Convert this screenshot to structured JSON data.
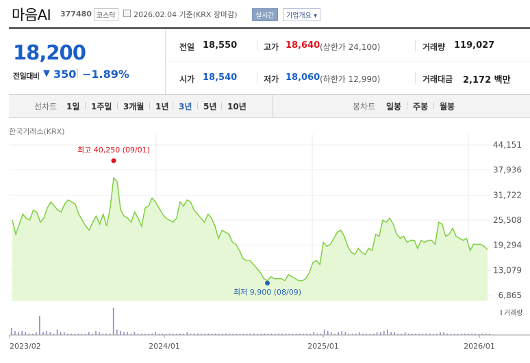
{
  "header": {
    "title": "마음AI",
    "code": "377480",
    "market": "코스닥",
    "date": "2026.02.04  기준(KRX 장마감)",
    "realtime": "실시간",
    "company_info": "기업개요 ▾"
  },
  "price": {
    "current": "18,200",
    "change_label": "전일대비",
    "change_arrow": "▼",
    "change_value": "350",
    "change_pct": "−1.89%"
  },
  "stats": {
    "prev_close_label": "전일",
    "prev_close": "18,550",
    "high_label": "고가",
    "high": "18,640",
    "upper_limit": "(상한가 24,100)",
    "volume_label": "거래량",
    "volume": "119,027",
    "open_label": "시가",
    "open": "18,540",
    "low_label": "저가",
    "low": "18,060",
    "lower_limit": "(하한가 12,990)",
    "value_label": "거래대금",
    "value": "2,172 백만"
  },
  "toolbar": {
    "line_label": "선차트",
    "periods": [
      "1일",
      "1주일",
      "3개월",
      "1년",
      "3년",
      "5년",
      "10년"
    ],
    "active_period": "3년",
    "candle_label": "봉차트",
    "candles": [
      "일봉",
      "주봉",
      "월봉"
    ]
  },
  "chart": {
    "exchange": "한국거래소(KRX)",
    "max_label": "최고 40,250 (09/01)",
    "min_label": "최저 9,900 (08/09)",
    "volume_legend": "거래량",
    "colors": {
      "line": "#7ccf3f",
      "fill": "#e6f7d6",
      "max": "#e0131b",
      "min": "#2b63b8",
      "volume": "#9b88c5"
    }
  },
  "chart_data": {
    "type": "area",
    "x_ticks": [
      "2023/02",
      "2024/01",
      "2025/01",
      "2026/01"
    ],
    "y_ticks": [
      "44,151",
      "37,936",
      "31,722",
      "25,508",
      "19,294",
      "13,079",
      "6,865"
    ],
    "ylim": [
      6865,
      44151
    ],
    "grid": true,
    "max_point": {
      "date": "09/01",
      "value": 40250
    },
    "min_point": {
      "date": "08/09",
      "value": 9900
    },
    "values": [
      25500,
      22000,
      24500,
      27000,
      26000,
      25500,
      28000,
      27500,
      25000,
      26000,
      28500,
      30000,
      29000,
      28000,
      27500,
      29500,
      30500,
      30000,
      29500,
      27000,
      25500,
      24000,
      23000,
      25000,
      26500,
      24500,
      27000,
      24000,
      28500,
      36000,
      35000,
      28000,
      26500,
      26000,
      25000,
      27500,
      26000,
      24000,
      28500,
      29000,
      31000,
      30000,
      28500,
      27000,
      26000,
      25500,
      25000,
      26000,
      30000,
      29000,
      30500,
      30000,
      28000,
      27000,
      26000,
      25000,
      27000,
      26000,
      24000,
      21000,
      23000,
      22500,
      22000,
      20000,
      19500,
      18000,
      16000,
      15500,
      15500,
      14500,
      13500,
      12500,
      11000,
      10500,
      11500,
      11000,
      11000,
      11000,
      10500,
      12000,
      11500,
      11000,
      10500,
      10500,
      11000,
      12500,
      15000,
      15500,
      14500,
      20000,
      19000,
      19500,
      21000,
      22500,
      23000,
      21500,
      19000,
      17500,
      17000,
      18500,
      17500,
      17000,
      18500,
      18000,
      22000,
      21500,
      25500,
      25000,
      26000,
      24500,
      22000,
      21000,
      21500,
      20000,
      20500,
      20500,
      18500,
      20500,
      20000,
      20500,
      20500,
      19500,
      25000,
      24500,
      21500,
      22000,
      23500,
      21500,
      21000,
      20500,
      21000,
      18000,
      19500,
      19500,
      19500,
      19000,
      18200
    ],
    "volume": [
      5,
      3,
      2,
      3,
      2,
      1,
      1,
      2,
      14,
      2,
      3,
      2,
      1,
      4,
      2,
      2,
      1,
      1,
      1,
      1,
      1,
      1,
      2,
      1,
      3,
      2,
      1,
      1,
      1,
      20,
      4,
      3,
      2,
      2,
      1,
      2,
      1,
      1,
      1,
      1,
      1,
      2,
      1,
      1,
      1,
      1,
      1,
      1,
      1,
      1,
      2,
      1,
      1,
      1,
      1,
      1,
      1,
      1,
      1,
      1,
      1,
      1,
      1,
      1,
      1,
      1,
      1,
      1,
      1,
      1,
      1,
      1,
      1,
      1,
      1,
      1,
      1,
      1,
      1,
      1,
      1,
      1,
      1,
      1,
      1,
      1,
      2,
      1,
      1,
      4,
      3,
      2,
      1,
      2,
      3,
      2,
      1,
      1,
      1,
      2,
      1,
      1,
      1,
      1,
      2,
      2,
      3,
      4,
      2,
      2,
      1,
      1,
      2,
      1,
      1,
      1,
      1,
      1,
      1,
      1,
      1,
      1,
      2,
      2,
      1,
      1,
      1,
      1,
      1,
      1,
      1,
      1,
      1,
      1,
      1,
      1,
      1
    ]
  }
}
